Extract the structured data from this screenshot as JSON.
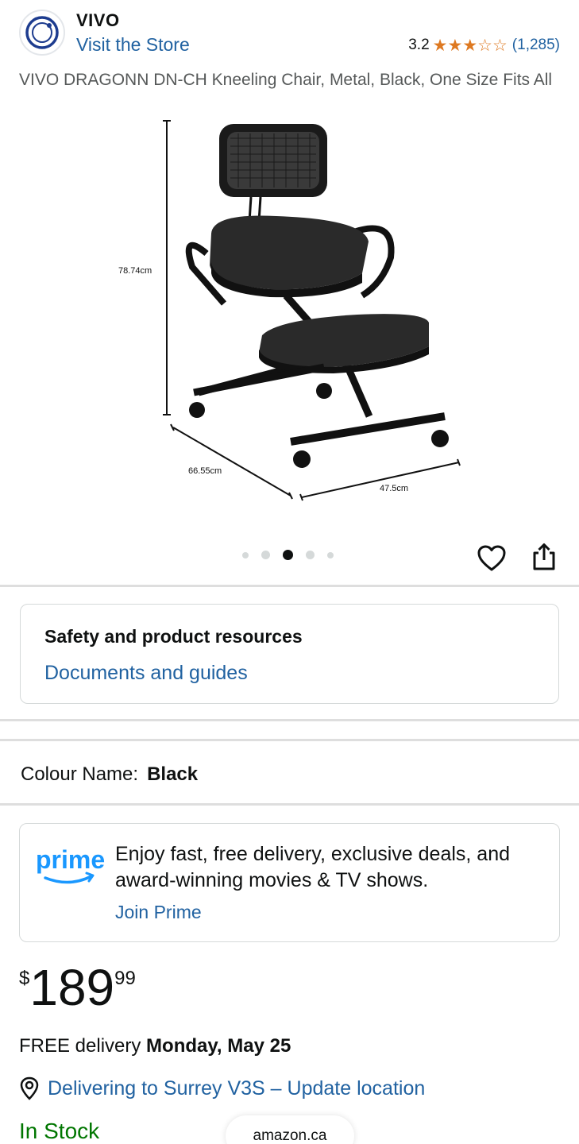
{
  "store": {
    "name": "VIVO",
    "visit_label": "Visit the Store",
    "rating_value": "3.2",
    "rating_stars": [
      "★",
      "★",
      "★",
      "☆",
      "☆"
    ],
    "rating_count": "(1,285)"
  },
  "product": {
    "title": "VIVO DRAGONN DN-CH Kneeling Chair, Metal, Black, One Size Fits All",
    "dimensions": {
      "height_label": "78.74cm",
      "depth_label": "66.55cm",
      "width_label": "47.5cm"
    },
    "image_carousel": {
      "count": 5,
      "active_index": 2
    }
  },
  "safety": {
    "title": "Safety and product resources",
    "link": "Documents and guides"
  },
  "colour": {
    "label": "Colour Name:",
    "value": "Black"
  },
  "prime": {
    "logo_text": "prime",
    "text": "Enjoy fast, free delivery, exclusive deals, and award-winning movies & TV shows.",
    "link": "Join Prime"
  },
  "price": {
    "symbol": "$",
    "whole": "189",
    "fraction": "99"
  },
  "delivery": {
    "prefix": "FREE delivery",
    "date": "Monday, May 25"
  },
  "location": {
    "text": "Delivering to Surrey V3S – Update location"
  },
  "stock": "In Stock",
  "browser": {
    "url": "amazon.ca"
  },
  "colors": {
    "link": "#2162a1",
    "star": "#de7921",
    "in_stock": "#007600",
    "prime_blue": "#1a98ff"
  },
  "icons": [
    "store-logo-icon",
    "star-icon",
    "heart-icon",
    "share-icon",
    "location-pin-icon",
    "prime-smile-icon"
  ]
}
